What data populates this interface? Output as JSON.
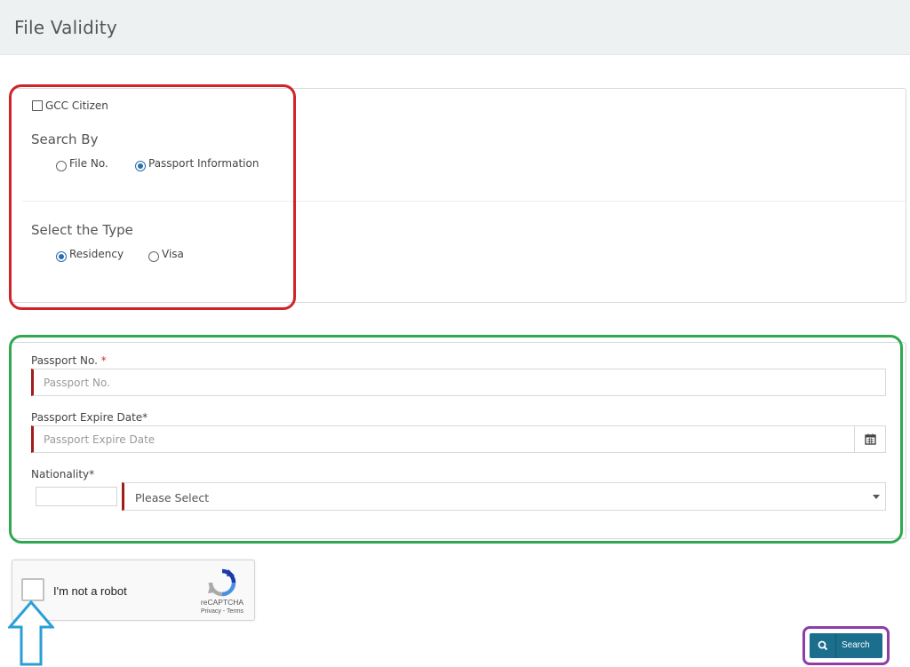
{
  "header": {
    "title": "File Validity"
  },
  "search_panel": {
    "gcc_citizen_label": "GCC Citizen",
    "gcc_citizen_checked": false,
    "search_by": {
      "heading": "Search By",
      "options": [
        {
          "label": "File No.",
          "selected": false
        },
        {
          "label": "Passport Information",
          "selected": true
        }
      ]
    },
    "select_type": {
      "heading": "Select the Type",
      "options": [
        {
          "label": "Residency",
          "selected": true
        },
        {
          "label": "Visa",
          "selected": false
        }
      ]
    }
  },
  "passport_form": {
    "passport_no": {
      "label": "Passport No.",
      "required_mark": "*",
      "placeholder": "Passport No.",
      "value": ""
    },
    "expire_date": {
      "label": "Passport Expire Date*",
      "placeholder": "Passport Expire Date",
      "value": "",
      "icon": "calendar-icon"
    },
    "nationality": {
      "label": "Nationality*",
      "code_value": "",
      "selected": "Please Select",
      "icon": "caret-down-icon"
    }
  },
  "captcha": {
    "label": "I'm not a robot",
    "brand": "reCAPTCHA",
    "links": "Privacy - Terms",
    "checked": false
  },
  "actions": {
    "search_label": "Search",
    "search_icon": "search-icon"
  },
  "annotations": {
    "red_box_color": "#d1232a",
    "green_box_color": "#2fa84f",
    "purple_box_color": "#8e3ea5",
    "arrow_color": "#2a9fd6"
  }
}
